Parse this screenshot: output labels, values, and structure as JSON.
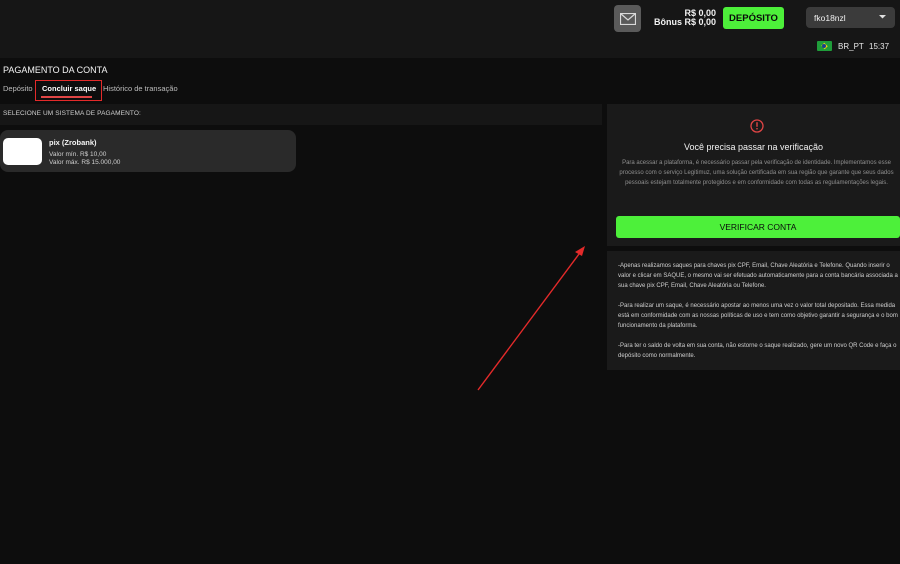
{
  "header": {
    "balance": "R$ 0,00",
    "bonus": "Bônus R$ 0,00",
    "deposit_button": "DEPÓSITO",
    "username": "fko18nzl",
    "locale": "BR_PT",
    "time": "15:37",
    "icons": {
      "mail": "mail-icon",
      "dropdown": "chevron-down-icon",
      "flag": "brazil-flag-icon"
    }
  },
  "page": {
    "title": "PAGAMENTO DA CONTA",
    "tabs": [
      {
        "label": "Depósito"
      },
      {
        "label": "Concluir saque",
        "active": true
      },
      {
        "label": "Histórico de transação"
      }
    ]
  },
  "payment": {
    "section_label": "SELECIONE UM SISTEMA DE PAGAMENTO:",
    "methods": [
      {
        "name": "pix (Zrobank)",
        "min": "Valor mín.  R$ 10,00",
        "max": "Valor máx.  R$ 15.000,00"
      }
    ]
  },
  "verification": {
    "title": "Você precisa passar na verificação",
    "text": "Para acessar a plataforma, é necessário passar pela verificação de identidade. Implementamos esse processo com o serviço Legitimuz, uma solução certificada em sua região que garante que seus dados pessoais estejam totalmente protegidos e em conformidade com todas as regulamentações legais.",
    "button": "VERIFICAR CONTA"
  },
  "info": {
    "paragraphs": [
      "-Apenas realizamos saques para chaves pix CPF, Email, Chave Aleatória e Telefone. Quando inserir o valor e clicar em SAQUE, o mesmo vai ser efetuado automaticamente para a conta bancária associada a sua chave pix CPF, Email, Chave Aleatória ou Telefone.",
      "-Para realizar um saque, é necessário apostar ao menos uma vez o valor total depositado. Essa medida está em conformidade com as nossas políticas de uso e tem como objetivo garantir a segurança e o bom funcionamento da plataforma.",
      "-Para ter o saldo de volta em sua conta, não estorne o saque realizado, gere um novo QR Code e faça o depósito como normalmente."
    ]
  },
  "colors": {
    "accent_green": "#4df03a",
    "annotation_red": "#e32a2a",
    "background": "#0d0d0d"
  }
}
